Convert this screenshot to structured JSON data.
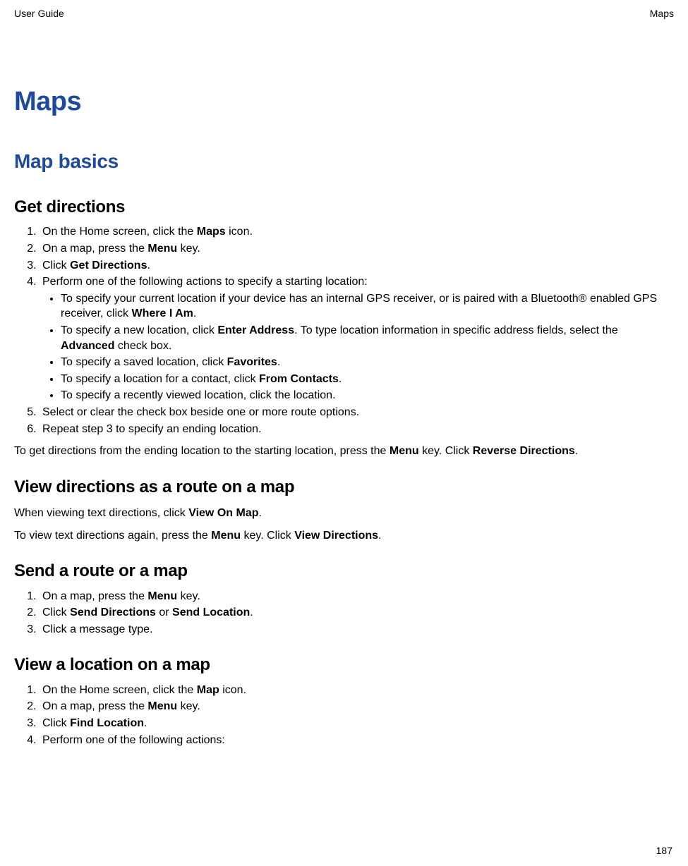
{
  "header": {
    "left": "User Guide",
    "right": "Maps"
  },
  "chapter_title": "Maps",
  "section_title": "Map basics",
  "topics": {
    "get_directions": {
      "title": "Get directions",
      "steps": {
        "s1_a": "On the Home screen, click the ",
        "s1_b": "Maps",
        "s1_c": " icon.",
        "s2_a": "On a map, press the ",
        "s2_b": "Menu",
        "s2_c": " key.",
        "s3_a": "Click ",
        "s3_b": "Get Directions",
        "s3_c": ".",
        "s4": "Perform one of the following actions to specify a starting location:",
        "s4_sub": {
          "a_a": "To specify your current location if your device has an internal GPS receiver, or is paired with a Bluetooth® enabled GPS receiver, click ",
          "a_b": "Where I Am",
          "a_c": ".",
          "b_a": "To specify a new location, click ",
          "b_b": "Enter Address",
          "b_c": ". To type location information in specific address fields, select the ",
          "b_d": "Advanced",
          "b_e": " check box.",
          "c_a": "To specify a saved location, click ",
          "c_b": "Favorites",
          "c_c": ".",
          "d_a": "To specify a location for a contact, click ",
          "d_b": "From Contacts",
          "d_c": ".",
          "e": "To specify a recently viewed location, click the location."
        },
        "s5": "Select or clear the check box beside one or more route options.",
        "s6": "Repeat step 3 to specify an ending location."
      },
      "after_a": "To get directions from the ending location to the starting location, press the ",
      "after_b": "Menu",
      "after_c": " key. Click ",
      "after_d": "Reverse Directions",
      "after_e": "."
    },
    "view_route": {
      "title": "View directions as a route on a map",
      "p1_a": "When viewing text directions, click ",
      "p1_b": "View On Map",
      "p1_c": ".",
      "p2_a": "To view text directions again, press the ",
      "p2_b": "Menu",
      "p2_c": " key. Click ",
      "p2_d": "View Directions",
      "p2_e": "."
    },
    "send_route": {
      "title": "Send a route or a map",
      "s1_a": "On a map, press the ",
      "s1_b": "Menu",
      "s1_c": " key.",
      "s2_a": "Click ",
      "s2_b": "Send Directions",
      "s2_c": " or ",
      "s2_d": "Send Location",
      "s2_e": ".",
      "s3": "Click a message type."
    },
    "view_location": {
      "title": "View a location on a map",
      "s1_a": "On the Home screen, click the ",
      "s1_b": "Map",
      "s1_c": " icon.",
      "s2_a": "On a map, press the ",
      "s2_b": "Menu",
      "s2_c": " key.",
      "s3_a": "Click ",
      "s3_b": "Find Location",
      "s3_c": ".",
      "s4": "Perform one of the following actions:"
    }
  },
  "page_number": "187"
}
